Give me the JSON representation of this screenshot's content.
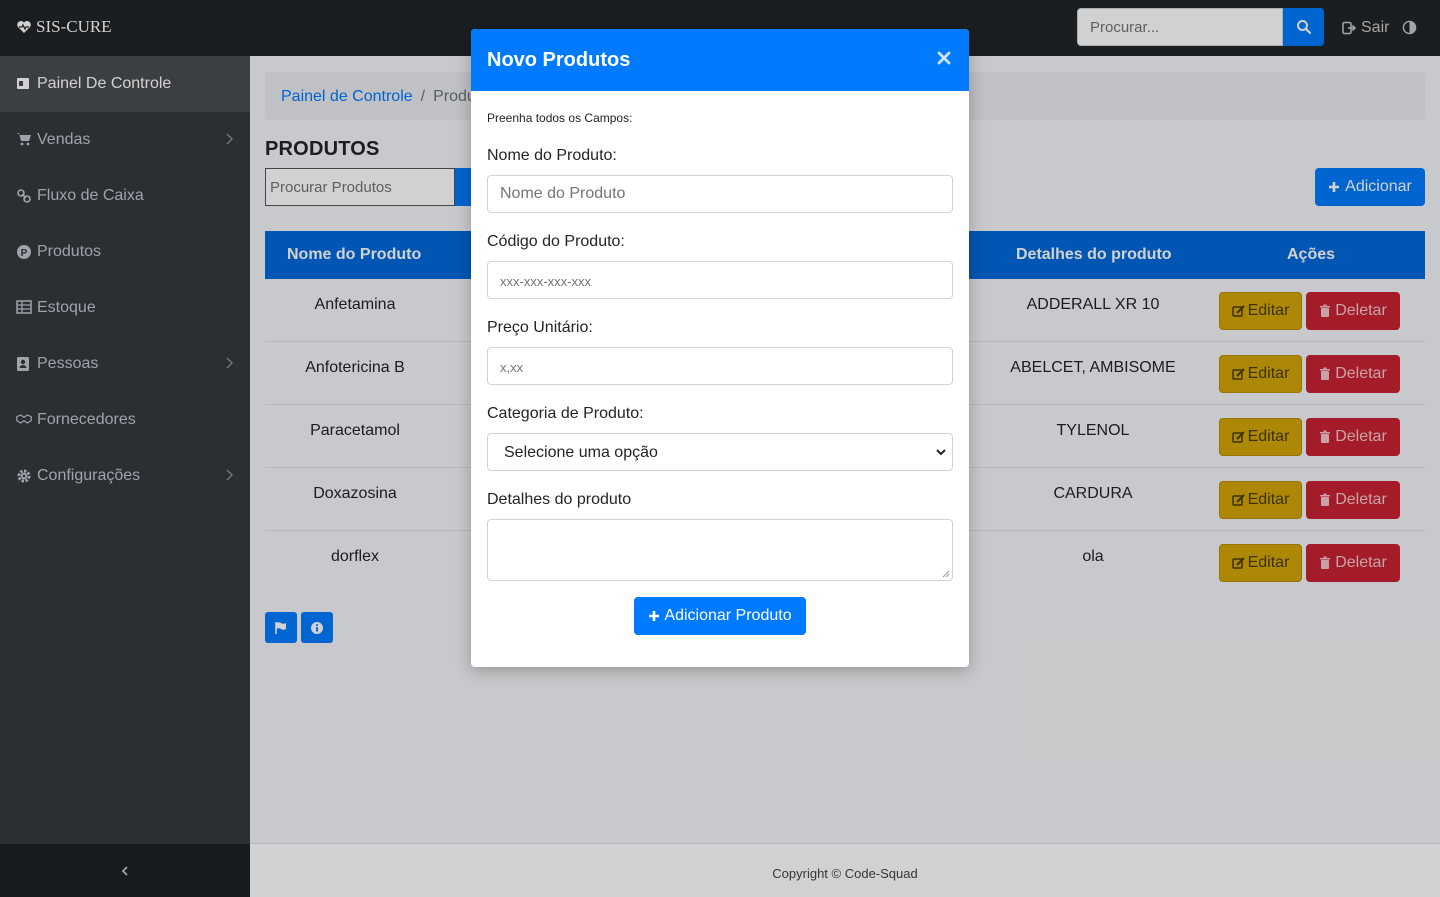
{
  "navbar": {
    "brand": "SIS-CURE",
    "search_placeholder": "Procurar...",
    "logout_label": "Sair"
  },
  "sidebar": {
    "items": [
      {
        "label": "Painel De Controle",
        "icon": "dashboard-icon",
        "active": true
      },
      {
        "label": "Vendas",
        "icon": "cart-icon",
        "has_children": true
      },
      {
        "label": "Fluxo de Caixa",
        "icon": "link-icon"
      },
      {
        "label": "Produtos",
        "icon": "product-icon"
      },
      {
        "label": "Estoque",
        "icon": "table-icon"
      },
      {
        "label": "Pessoas",
        "icon": "contact-icon",
        "has_children": true
      },
      {
        "label": "Fornecedores",
        "icon": "handshake-icon"
      },
      {
        "label": "Configurações",
        "icon": "gear-icon",
        "has_children": true
      }
    ]
  },
  "breadcrumb": {
    "home": "Painel de Controle",
    "separator": "/",
    "current": "Produ"
  },
  "page": {
    "title": "PRODUTOS",
    "search_placeholder": "Procurar Produtos",
    "add_label": "Adicionar"
  },
  "table": {
    "headers": [
      "Nome do Produto",
      "Detalhes do produto",
      "Ações"
    ],
    "rows": [
      {
        "name": "Anfetamina",
        "details": "ADDERALL XR 10"
      },
      {
        "name": "Anfotericina B",
        "details": "ABELCET, AMBISOME"
      },
      {
        "name": "Paracetamol",
        "details": "TYLENOL"
      },
      {
        "name": "Doxazosina",
        "details": "CARDURA"
      },
      {
        "name": "dorflex",
        "details": "ola"
      }
    ],
    "edit_label": "Editar",
    "delete_label": "Deletar"
  },
  "footer": {
    "copyright": "Copyright © Code-Squad"
  },
  "modal": {
    "title": "Novo Produtos",
    "hint": "Preenha todos os Campos:",
    "name_label": "Nome do Produto:",
    "name_placeholder": "Nome do Produto",
    "code_label": "Código do Produto:",
    "code_placeholder": "xxx-xxx-xxx-xxx",
    "price_label": "Preço Unitário:",
    "price_placeholder": "x,xx",
    "category_label": "Categoria de Produto:",
    "category_selected": "Selecione uma opção",
    "details_label": "Detalhes do produto",
    "submit_label": "Adicionar Produto"
  },
  "colors": {
    "primary": "#007bff",
    "warning": "#d4a609",
    "danger": "#c82333",
    "sidebar": "#343a40"
  }
}
